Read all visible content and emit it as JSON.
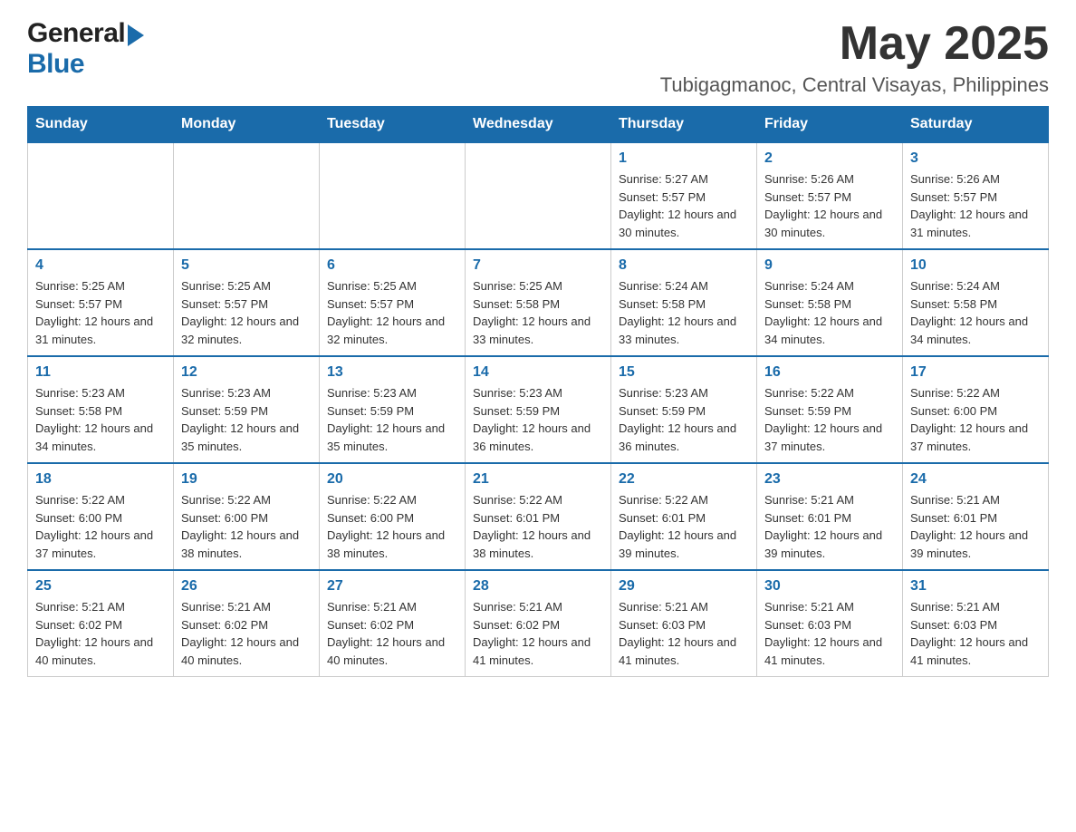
{
  "header": {
    "month_year": "May 2025",
    "location": "Tubigagmanoc, Central Visayas, Philippines",
    "logo_general": "General",
    "logo_blue": "Blue"
  },
  "days_of_week": [
    "Sunday",
    "Monday",
    "Tuesday",
    "Wednesday",
    "Thursday",
    "Friday",
    "Saturday"
  ],
  "weeks": [
    [
      {
        "day": "",
        "info": ""
      },
      {
        "day": "",
        "info": ""
      },
      {
        "day": "",
        "info": ""
      },
      {
        "day": "",
        "info": ""
      },
      {
        "day": "1",
        "info": "Sunrise: 5:27 AM\nSunset: 5:57 PM\nDaylight: 12 hours and 30 minutes."
      },
      {
        "day": "2",
        "info": "Sunrise: 5:26 AM\nSunset: 5:57 PM\nDaylight: 12 hours and 30 minutes."
      },
      {
        "day": "3",
        "info": "Sunrise: 5:26 AM\nSunset: 5:57 PM\nDaylight: 12 hours and 31 minutes."
      }
    ],
    [
      {
        "day": "4",
        "info": "Sunrise: 5:25 AM\nSunset: 5:57 PM\nDaylight: 12 hours and 31 minutes."
      },
      {
        "day": "5",
        "info": "Sunrise: 5:25 AM\nSunset: 5:57 PM\nDaylight: 12 hours and 32 minutes."
      },
      {
        "day": "6",
        "info": "Sunrise: 5:25 AM\nSunset: 5:57 PM\nDaylight: 12 hours and 32 minutes."
      },
      {
        "day": "7",
        "info": "Sunrise: 5:25 AM\nSunset: 5:58 PM\nDaylight: 12 hours and 33 minutes."
      },
      {
        "day": "8",
        "info": "Sunrise: 5:24 AM\nSunset: 5:58 PM\nDaylight: 12 hours and 33 minutes."
      },
      {
        "day": "9",
        "info": "Sunrise: 5:24 AM\nSunset: 5:58 PM\nDaylight: 12 hours and 34 minutes."
      },
      {
        "day": "10",
        "info": "Sunrise: 5:24 AM\nSunset: 5:58 PM\nDaylight: 12 hours and 34 minutes."
      }
    ],
    [
      {
        "day": "11",
        "info": "Sunrise: 5:23 AM\nSunset: 5:58 PM\nDaylight: 12 hours and 34 minutes."
      },
      {
        "day": "12",
        "info": "Sunrise: 5:23 AM\nSunset: 5:59 PM\nDaylight: 12 hours and 35 minutes."
      },
      {
        "day": "13",
        "info": "Sunrise: 5:23 AM\nSunset: 5:59 PM\nDaylight: 12 hours and 35 minutes."
      },
      {
        "day": "14",
        "info": "Sunrise: 5:23 AM\nSunset: 5:59 PM\nDaylight: 12 hours and 36 minutes."
      },
      {
        "day": "15",
        "info": "Sunrise: 5:23 AM\nSunset: 5:59 PM\nDaylight: 12 hours and 36 minutes."
      },
      {
        "day": "16",
        "info": "Sunrise: 5:22 AM\nSunset: 5:59 PM\nDaylight: 12 hours and 37 minutes."
      },
      {
        "day": "17",
        "info": "Sunrise: 5:22 AM\nSunset: 6:00 PM\nDaylight: 12 hours and 37 minutes."
      }
    ],
    [
      {
        "day": "18",
        "info": "Sunrise: 5:22 AM\nSunset: 6:00 PM\nDaylight: 12 hours and 37 minutes."
      },
      {
        "day": "19",
        "info": "Sunrise: 5:22 AM\nSunset: 6:00 PM\nDaylight: 12 hours and 38 minutes."
      },
      {
        "day": "20",
        "info": "Sunrise: 5:22 AM\nSunset: 6:00 PM\nDaylight: 12 hours and 38 minutes."
      },
      {
        "day": "21",
        "info": "Sunrise: 5:22 AM\nSunset: 6:01 PM\nDaylight: 12 hours and 38 minutes."
      },
      {
        "day": "22",
        "info": "Sunrise: 5:22 AM\nSunset: 6:01 PM\nDaylight: 12 hours and 39 minutes."
      },
      {
        "day": "23",
        "info": "Sunrise: 5:21 AM\nSunset: 6:01 PM\nDaylight: 12 hours and 39 minutes."
      },
      {
        "day": "24",
        "info": "Sunrise: 5:21 AM\nSunset: 6:01 PM\nDaylight: 12 hours and 39 minutes."
      }
    ],
    [
      {
        "day": "25",
        "info": "Sunrise: 5:21 AM\nSunset: 6:02 PM\nDaylight: 12 hours and 40 minutes."
      },
      {
        "day": "26",
        "info": "Sunrise: 5:21 AM\nSunset: 6:02 PM\nDaylight: 12 hours and 40 minutes."
      },
      {
        "day": "27",
        "info": "Sunrise: 5:21 AM\nSunset: 6:02 PM\nDaylight: 12 hours and 40 minutes."
      },
      {
        "day": "28",
        "info": "Sunrise: 5:21 AM\nSunset: 6:02 PM\nDaylight: 12 hours and 41 minutes."
      },
      {
        "day": "29",
        "info": "Sunrise: 5:21 AM\nSunset: 6:03 PM\nDaylight: 12 hours and 41 minutes."
      },
      {
        "day": "30",
        "info": "Sunrise: 5:21 AM\nSunset: 6:03 PM\nDaylight: 12 hours and 41 minutes."
      },
      {
        "day": "31",
        "info": "Sunrise: 5:21 AM\nSunset: 6:03 PM\nDaylight: 12 hours and 41 minutes."
      }
    ]
  ]
}
